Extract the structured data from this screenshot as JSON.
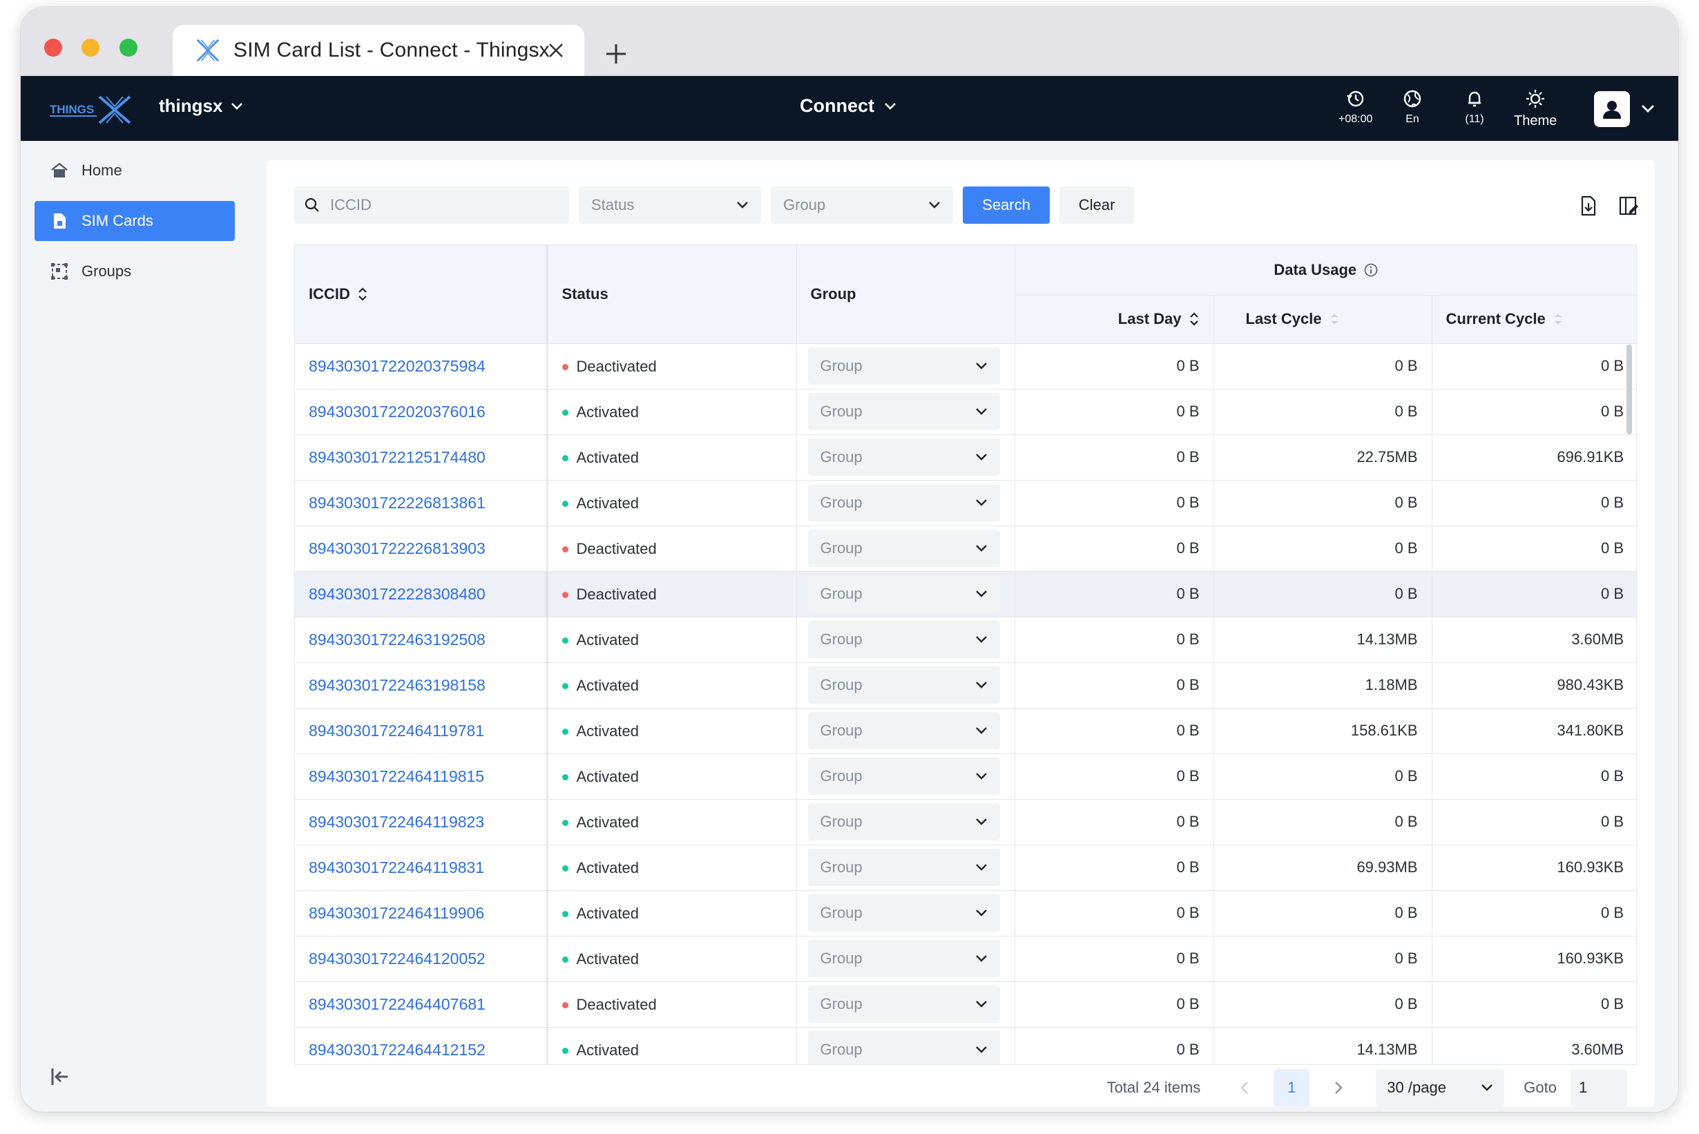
{
  "browser": {
    "tab_title": "SIM Card List - Connect - Thingsx"
  },
  "topnav": {
    "org_name": "thingsx",
    "product_name": "Connect",
    "timezone": "+08:00",
    "language": "En",
    "notifications": "(11)",
    "theme_label": "Theme",
    "bg_color": "#0b1626"
  },
  "sidebar": {
    "items": [
      {
        "label": "Home",
        "icon": "home-icon",
        "active": false
      },
      {
        "label": "SIM Cards",
        "icon": "sim-card-icon",
        "active": true
      },
      {
        "label": "Groups",
        "icon": "groups-icon",
        "active": false
      }
    ],
    "accent": "#3b82f6"
  },
  "filters": {
    "iccid_placeholder": "ICCID",
    "status_placeholder": "Status",
    "group_placeholder": "Group",
    "search_label": "Search",
    "clear_label": "Clear"
  },
  "table": {
    "headers": {
      "iccid": "ICCID",
      "status": "Status",
      "group": "Group",
      "data_usage": "Data Usage",
      "last_day": "Last Day",
      "last_cycle": "Last Cycle",
      "current_cycle": "Current Cycle"
    },
    "status_colors": {
      "Activated": "#14c9a0",
      "Deactivated": "#f5645e"
    },
    "rows": [
      {
        "iccid": "89430301722020375984",
        "status": "Deactivated",
        "group": "Group",
        "last_day": "0 B",
        "last_cycle": "0 B",
        "current_cycle": "0 B"
      },
      {
        "iccid": "89430301722020376016",
        "status": "Activated",
        "group": "Group",
        "last_day": "0 B",
        "last_cycle": "0 B",
        "current_cycle": "0 B"
      },
      {
        "iccid": "89430301722125174480",
        "status": "Activated",
        "group": "Group",
        "last_day": "0 B",
        "last_cycle": "22.75MB",
        "current_cycle": "696.91KB"
      },
      {
        "iccid": "89430301722226813861",
        "status": "Activated",
        "group": "Group",
        "last_day": "0 B",
        "last_cycle": "0 B",
        "current_cycle": "0 B"
      },
      {
        "iccid": "89430301722226813903",
        "status": "Deactivated",
        "group": "Group",
        "last_day": "0 B",
        "last_cycle": "0 B",
        "current_cycle": "0 B"
      },
      {
        "iccid": "89430301722228308480",
        "status": "Deactivated",
        "group": "Group",
        "last_day": "0 B",
        "last_cycle": "0 B",
        "current_cycle": "0 B"
      },
      {
        "iccid": "89430301722463192508",
        "status": "Activated",
        "group": "Group",
        "last_day": "0 B",
        "last_cycle": "14.13MB",
        "current_cycle": "3.60MB"
      },
      {
        "iccid": "89430301722463198158",
        "status": "Activated",
        "group": "Group",
        "last_day": "0 B",
        "last_cycle": "1.18MB",
        "current_cycle": "980.43KB"
      },
      {
        "iccid": "89430301722464119781",
        "status": "Activated",
        "group": "Group",
        "last_day": "0 B",
        "last_cycle": "158.61KB",
        "current_cycle": "341.80KB"
      },
      {
        "iccid": "89430301722464119815",
        "status": "Activated",
        "group": "Group",
        "last_day": "0 B",
        "last_cycle": "0 B",
        "current_cycle": "0 B"
      },
      {
        "iccid": "89430301722464119823",
        "status": "Activated",
        "group": "Group",
        "last_day": "0 B",
        "last_cycle": "0 B",
        "current_cycle": "0 B"
      },
      {
        "iccid": "89430301722464119831",
        "status": "Activated",
        "group": "Group",
        "last_day": "0 B",
        "last_cycle": "69.93MB",
        "current_cycle": "160.93KB"
      },
      {
        "iccid": "89430301722464119906",
        "status": "Activated",
        "group": "Group",
        "last_day": "0 B",
        "last_cycle": "0 B",
        "current_cycle": "0 B"
      },
      {
        "iccid": "89430301722464120052",
        "status": "Activated",
        "group": "Group",
        "last_day": "0 B",
        "last_cycle": "0 B",
        "current_cycle": "160.93KB"
      },
      {
        "iccid": "89430301722464407681",
        "status": "Deactivated",
        "group": "Group",
        "last_day": "0 B",
        "last_cycle": "0 B",
        "current_cycle": "0 B"
      },
      {
        "iccid": "89430301722464412152",
        "status": "Activated",
        "group": "Group",
        "last_day": "0 B",
        "last_cycle": "14.13MB",
        "current_cycle": "3.60MB"
      }
    ]
  },
  "pagination": {
    "total": "Total 24 items",
    "current_page": "1",
    "page_size": "30 /page",
    "goto_label": "Goto",
    "goto_value": "1"
  }
}
